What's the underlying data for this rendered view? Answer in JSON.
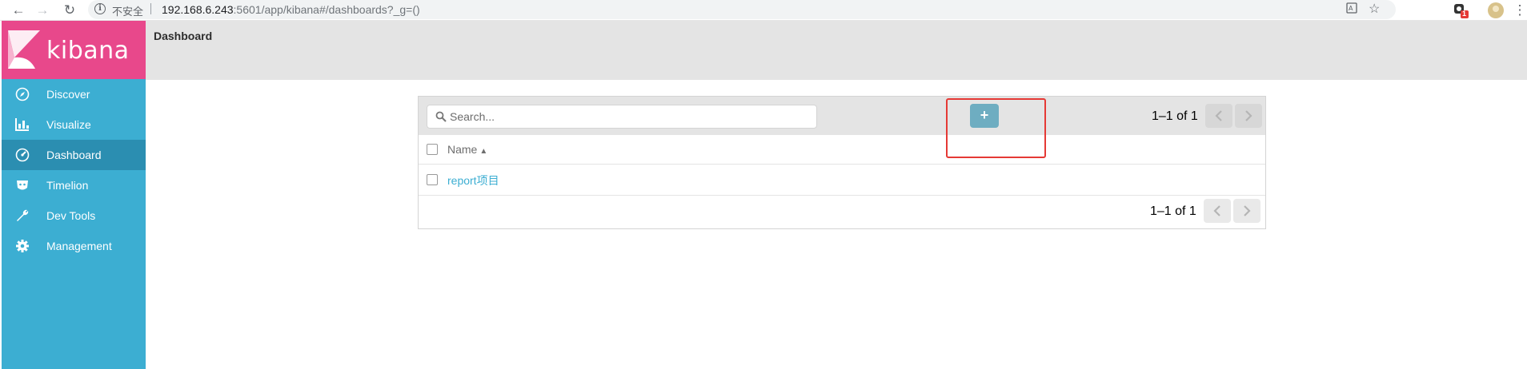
{
  "browser": {
    "insecure_label": "不安全",
    "url_host": "192.168.6.243",
    "url_path": ":5601/app/kibana#/dashboards?_g=()",
    "extension_badge": "1"
  },
  "sidebar": {
    "logo_text": "kibana",
    "items": [
      {
        "label": "Discover",
        "icon": "compass-icon",
        "active": false
      },
      {
        "label": "Visualize",
        "icon": "bar-chart-icon",
        "active": false
      },
      {
        "label": "Dashboard",
        "icon": "dashboard-icon",
        "active": true
      },
      {
        "label": "Timelion",
        "icon": "timelion-icon",
        "active": false
      },
      {
        "label": "Dev Tools",
        "icon": "wrench-icon",
        "active": false
      },
      {
        "label": "Management",
        "icon": "gear-icon",
        "active": false
      }
    ]
  },
  "header": {
    "title": "Dashboard"
  },
  "listing": {
    "search_placeholder": "Search...",
    "add_label": "+",
    "pager_top": "1–1 of 1",
    "column_name": "Name",
    "sort_caret": "▲",
    "rows": [
      {
        "title": "report项目"
      }
    ],
    "pager_bottom": "1–1 of 1"
  },
  "colors": {
    "sidebar": "#3caed2",
    "sidebar_active": "#2b8eb1",
    "logo_bg": "#e8488b",
    "header_bg": "#e4e4e4",
    "link": "#3caed2",
    "add_button": "#6eadc1",
    "annotation": "#e53935"
  }
}
